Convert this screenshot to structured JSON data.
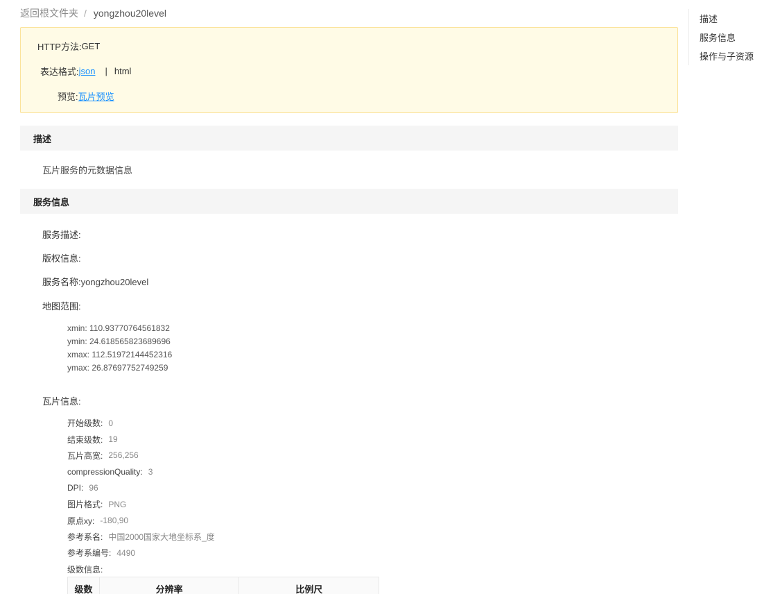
{
  "breadcrumb": {
    "back_label": "返回根文件夹",
    "separator": "/",
    "current": "yongzhou20level"
  },
  "info": {
    "http_method_label": "HTTP方法:",
    "http_method_value": "GET",
    "format_label": "表达格式:",
    "format_json": "json",
    "format_pipe": "|",
    "format_html": "html",
    "preview_label": "预览:",
    "preview_link": "瓦片预览"
  },
  "description": {
    "heading": "描述",
    "text": "瓦片服务的元数据信息"
  },
  "service": {
    "heading": "服务信息",
    "desc_label": "服务描述:",
    "copyright_label": "版权信息:",
    "name_label": "服务名称:",
    "name_value": "yongzhou20level",
    "extent_label": "地图范围:",
    "extent": [
      "xmin: 110.93770764561832",
      "ymin: 24.618565823689696",
      "xmax: 112.51972144452316",
      "ymax: 26.87697752749259"
    ],
    "tile_label": "瓦片信息:",
    "tile_items": [
      {
        "k": "开始级数:",
        "v": "0"
      },
      {
        "k": "结束级数:",
        "v": "19"
      },
      {
        "k": "瓦片高宽:",
        "v": "256,256"
      },
      {
        "k": "compressionQuality:",
        "v": "3"
      },
      {
        "k": "DPI:",
        "v": "96"
      },
      {
        "k": "图片格式:",
        "v": "PNG"
      },
      {
        "k": "原点xy:",
        "v": "-180,90"
      },
      {
        "k": "参考系名:",
        "v": "中国2000国家大地坐标系_度"
      },
      {
        "k": "参考系编号:",
        "v": "4490"
      },
      {
        "k": "级数信息:",
        "v": ""
      }
    ],
    "level_table_headers": [
      "级数",
      "分辨率",
      "比例尺"
    ]
  },
  "side_nav": [
    "描述",
    "服务信息",
    "操作与子资源"
  ]
}
